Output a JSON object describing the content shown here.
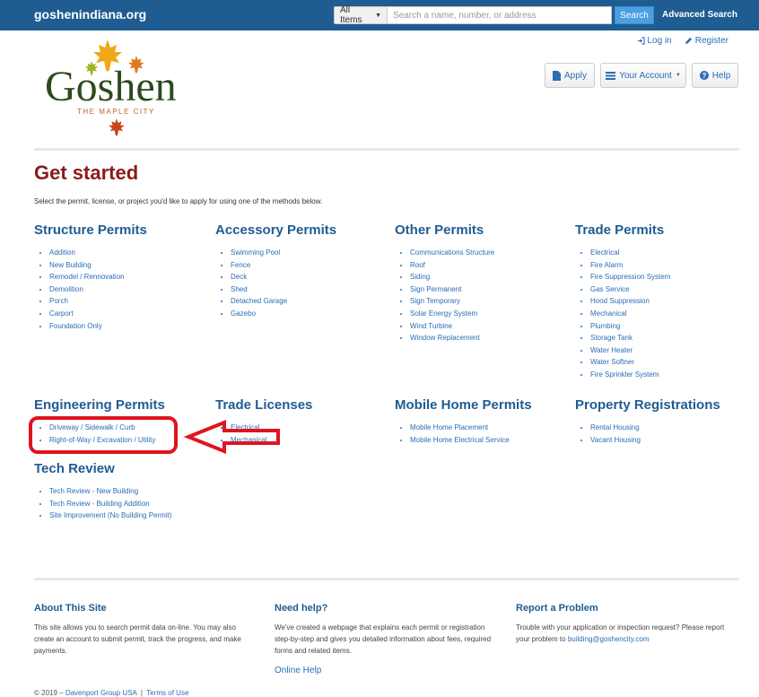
{
  "topbar": {
    "site_title": "goshenindiana.org",
    "filter_label": "All Items",
    "search_placeholder": "Search a name, number, or address",
    "search_button": "Search",
    "advanced_search": "Advanced Search"
  },
  "header": {
    "login": "Log in",
    "register": "Register",
    "logo": {
      "name": "Goshen",
      "tagline": "THE MAPLE CITY"
    },
    "buttons": {
      "apply": "Apply",
      "account": "Your Account",
      "help": "Help"
    }
  },
  "main": {
    "title": "Get started",
    "instructions": "Select the permit, license, or project you'd like to apply for using one of the methods below.",
    "categories": [
      {
        "title": "Structure Permits",
        "items": [
          "Addition",
          "New Building",
          "Remodel / Rennovation",
          "Demolition",
          "Porch",
          "Carport",
          "Foundation Only"
        ]
      },
      {
        "title": "Accessory Permits",
        "items": [
          "Swimming Pool",
          "Fence",
          "Deck",
          "Shed",
          "Detached Garage",
          "Gazebo"
        ]
      },
      {
        "title": "Other Permits",
        "items": [
          "Communications Structure",
          "Roof",
          "Siding",
          "Sign Permanent",
          "Sign Temporary",
          "Solar Energy System",
          "Wind Turbine",
          "Window Replacement"
        ]
      },
      {
        "title": "Trade Permits",
        "items": [
          "Electrical",
          "Fire Alarm",
          "Fire Suppression System",
          "Gas Service",
          "Hood Suppression",
          "Mechanical",
          "Plumbing",
          "Storage Tank",
          "Water Heater",
          "Water Softner",
          "Fire Sprinkler System"
        ]
      },
      {
        "title": "Engineering Permits",
        "items": [
          "Driveway / Sidewalk / Curb",
          "Right-of-Way / Excavation / Utility"
        ]
      },
      {
        "title": "Trade Licenses",
        "items": [
          "Electrical",
          "Mechanical"
        ]
      },
      {
        "title": "Mobile Home Permits",
        "items": [
          "Mobile Home Placement",
          "Mobile Home Electrical Service"
        ]
      },
      {
        "title": "Property Registrations",
        "items": [
          "Rental Housing",
          "Vacant Housing"
        ]
      },
      {
        "title": "Tech Review",
        "items": [
          "Tech Review - New Building",
          "Tech Review - Building Addition",
          "Site Improvement (No Building Permit)"
        ]
      }
    ]
  },
  "footer": {
    "about": {
      "title": "About This Site",
      "text": "This site allows you to search permit data on-line. You may also create an account to submit permit, track the progress, and make payments."
    },
    "help": {
      "title": "Need help?",
      "text": "We've created a webpage that explains each permit or registration step-by-step and gives you detailed information about fees, required forms and related items.",
      "link": "Online Help"
    },
    "report": {
      "title": "Report a Problem",
      "text": "Trouble with your application or inspection request? Please report your problem to ",
      "email": "building@goshencity.com"
    },
    "copyright": "© 2019 –",
    "company": "Davenport Group USA",
    "separator": "|",
    "terms": "Terms of Use"
  },
  "colors": {
    "topbar": "#1f5c92",
    "heading": "#8b1a1a",
    "link": "#2a6db5",
    "annotation": "#e0141e"
  },
  "icons": [
    "caret-down-icon",
    "login-icon",
    "register-pencil-icon",
    "document-icon",
    "list-icon",
    "help-circle-icon",
    "maple-leaf-icon"
  ]
}
